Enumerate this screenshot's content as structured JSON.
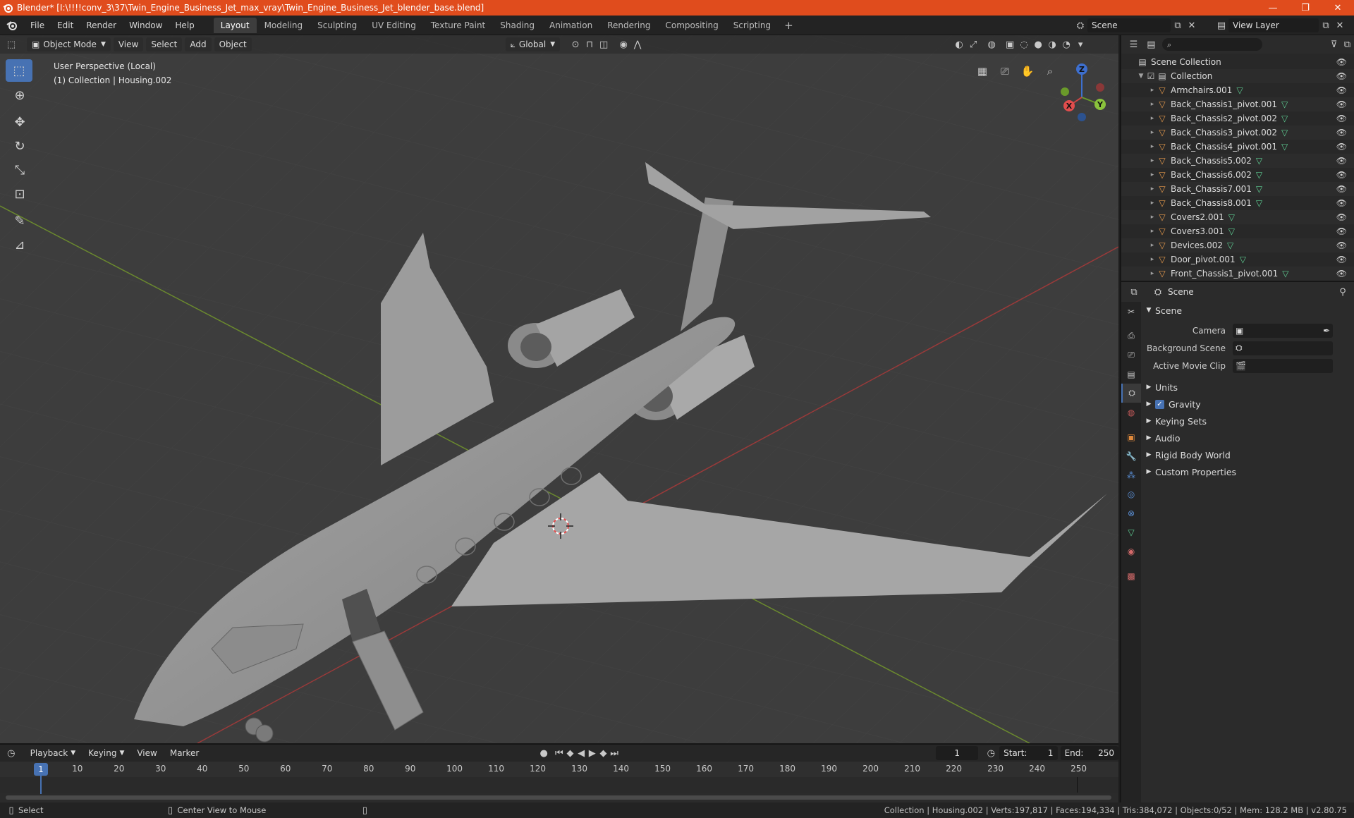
{
  "window": {
    "title": "Blender* [I:\\!!!!conv_3\\37\\Twin_Engine_Business_Jet_max_vray\\Twin_Engine_Business_Jet_blender_base.blend]",
    "minimize": "—",
    "maximize": "❐",
    "close": "✕"
  },
  "menubar": {
    "items": [
      "File",
      "Edit",
      "Render",
      "Window",
      "Help"
    ],
    "workspaces": [
      "Layout",
      "Modeling",
      "Sculpting",
      "UV Editing",
      "Texture Paint",
      "Shading",
      "Animation",
      "Rendering",
      "Compositing",
      "Scripting"
    ],
    "active_workspace": "Layout",
    "add_tab": "+",
    "scene": "Scene",
    "view_layer": "View Layer"
  },
  "viewport": {
    "mode": "Object Mode",
    "menus": [
      "View",
      "Select",
      "Add",
      "Object"
    ],
    "transform_orientation": "Global",
    "info_line1": "User Perspective (Local)",
    "info_line2": "(1) Collection | Housing.002",
    "gizmo": {
      "z": "Z",
      "y": "Y",
      "x": "X"
    }
  },
  "timeline": {
    "menus": [
      "Playback",
      "Keying",
      "View",
      "Marker"
    ],
    "current_frame": "1",
    "start_label": "Start:",
    "start": "1",
    "end_label": "End:",
    "end": "250",
    "ticks": [
      "10",
      "20",
      "30",
      "40",
      "50",
      "60",
      "70",
      "80",
      "90",
      "100",
      "110",
      "120",
      "130",
      "140",
      "150",
      "160",
      "170",
      "180",
      "190",
      "200",
      "210",
      "220",
      "230",
      "240",
      "250"
    ],
    "playhead": "1"
  },
  "statusbar": {
    "select": "Select",
    "center": "Center View to Mouse",
    "stats": "Collection | Housing.002 | Verts:197,817 | Faces:194,334 | Tris:384,072 | Objects:0/52 | Mem: 128.2 MB | v2.80.75"
  },
  "outliner": {
    "scene_collection": "Scene Collection",
    "collection": "Collection",
    "items": [
      "Armchairs.001",
      "Back_Chassis1_pivot.001",
      "Back_Chassis2_pivot.002",
      "Back_Chassis3_pivot.002",
      "Back_Chassis4_pivot.001",
      "Back_Chassis5.002",
      "Back_Chassis6.002",
      "Back_Chassis7.001",
      "Back_Chassis8.001",
      "Covers2.001",
      "Covers3.001",
      "Devices.002",
      "Door_pivot.001",
      "Front_Chassis1_pivot.001"
    ]
  },
  "properties": {
    "context": "Scene",
    "panel": "Scene",
    "fields": {
      "camera": "Camera",
      "background_scene": "Background Scene",
      "active_movie_clip": "Active Movie Clip"
    },
    "subpanels": [
      "Units",
      "Gravity",
      "Keying Sets",
      "Audio",
      "Rigid Body World",
      "Custom Properties"
    ]
  }
}
